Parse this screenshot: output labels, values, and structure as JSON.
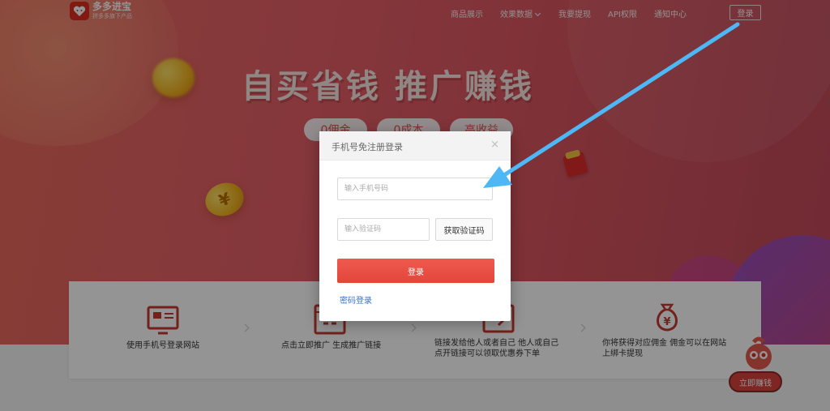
{
  "brand": {
    "title": "多多进宝",
    "subtitle": "拼多多旗下产品",
    "color": "#e02e24"
  },
  "nav": {
    "items": [
      {
        "label": "商品展示"
      },
      {
        "label": "效果数据"
      },
      {
        "label": "我要提现"
      },
      {
        "label": "API权限"
      },
      {
        "label": "通知中心"
      }
    ],
    "login_label": "登录"
  },
  "hero": {
    "slogan": "自买省钱 推广赚钱",
    "pills": [
      "0佣金",
      "0成本",
      "高收益"
    ]
  },
  "steps": [
    {
      "text": "使用手机号登录网站",
      "icon": "monitor-icon"
    },
    {
      "text": "点击立即推广 生成推广链接",
      "icon": "link-icon"
    },
    {
      "text": "链接发给他人或者自己 他人或自己点开链接可以领取优惠券下单",
      "icon": "coupon-icon"
    },
    {
      "text": "你将获得对应佣金 佣金可以在网站上绑卡提现",
      "icon": "money-bag-icon"
    }
  ],
  "login_modal": {
    "title": "手机号免注册登录",
    "close_glyph": "×",
    "phone_placeholder": "输入手机号码",
    "code_placeholder": "输入验证码",
    "get_code_label": "获取验证码",
    "submit_label": "登录",
    "password_login_label": "密码登录"
  },
  "float_button": {
    "label": "立即赚钱"
  },
  "colors": {
    "accent_red": "#e2463b",
    "link_blue": "#3a72c4",
    "annotation_arrow": "#4db8f5"
  }
}
